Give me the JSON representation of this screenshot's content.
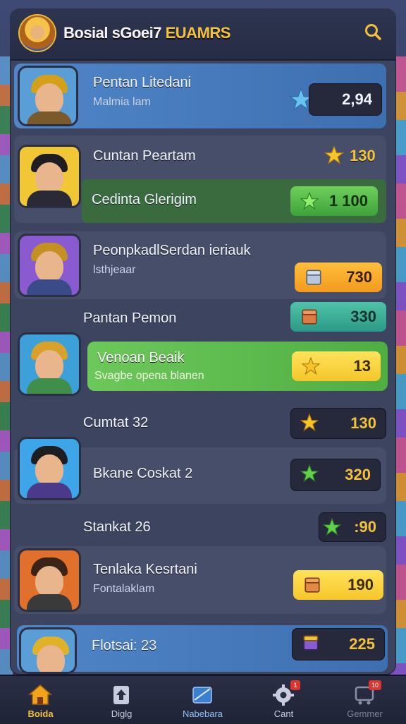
{
  "header": {
    "title_part1": "Bosial sGoei7 ",
    "title_part2": "EUAMRS"
  },
  "colors": {
    "accent": "#f3c13b",
    "panel": "#3c4460",
    "green": "#4bb04a"
  },
  "rows": [
    {
      "name": "Pentan Litedani",
      "sub": "Malmia lam",
      "value": "2,94",
      "icon": "star-icon"
    },
    {
      "name": "Cuntan Peartam",
      "value": "130",
      "icon": "star-icon"
    },
    {
      "name": "Cedinta Glerigim",
      "value": "1 100",
      "icon": "star-icon"
    },
    {
      "name": "PeonpkadlSerdan ieriauk",
      "sub": "lsthjeaar",
      "value": "730",
      "icon": "chest-icon"
    },
    {
      "name": "Pantan Pemon",
      "value": "330",
      "icon": "chest-icon"
    },
    {
      "name": "Venoan Beaik",
      "sub": "Svagbe opena blanen",
      "value": "13",
      "icon": "star-icon"
    },
    {
      "name": "Cumtat 32",
      "value": "130",
      "icon": "star-icon"
    },
    {
      "name": "Bkane Coskat 2",
      "value": "320",
      "icon": "star-icon"
    },
    {
      "name": "Stankat 26",
      "value": ":90",
      "icon": "star-icon"
    },
    {
      "name": "Tenlaka Kesrtani",
      "sub": "Fontalaklam",
      "value": "190",
      "icon": "chest-icon"
    },
    {
      "name": "Flotsai: 23",
      "value": "225",
      "icon": "chest-icon"
    }
  ],
  "nav": [
    {
      "label": "Boida",
      "icon": "home-icon"
    },
    {
      "label": "Diglg",
      "icon": "upload-icon"
    },
    {
      "label": "Nabebara",
      "icon": "map-icon"
    },
    {
      "label": "Cant",
      "icon": "gear-icon",
      "badge": "1"
    },
    {
      "label": "Gemmer",
      "icon": "cart-icon",
      "badge": "10"
    }
  ]
}
